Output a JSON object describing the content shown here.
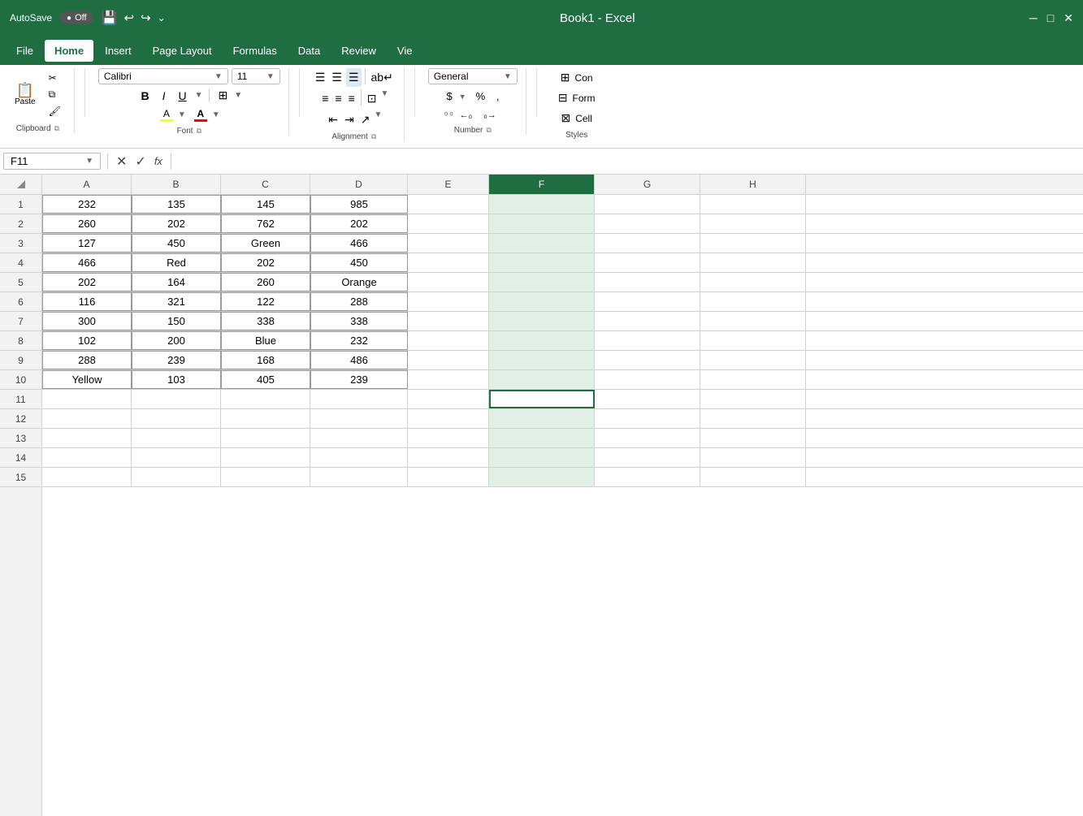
{
  "titleBar": {
    "autosave": "AutoSave",
    "autosave_state": "Off",
    "title": "Book1 - Excel",
    "quickAccess": [
      "save-icon",
      "undo-icon",
      "redo-icon",
      "customize-icon"
    ]
  },
  "menuBar": {
    "items": [
      "File",
      "Home",
      "Insert",
      "Page Layout",
      "Formulas",
      "Data",
      "Review",
      "View"
    ],
    "active": "Home"
  },
  "ribbon": {
    "groups": {
      "clipboard": {
        "label": "Clipboard",
        "paste_label": "Paste"
      },
      "font": {
        "label": "Font",
        "font_name": "Calibri",
        "font_size": "11",
        "bold": "B",
        "italic": "I",
        "underline": "U"
      },
      "alignment": {
        "label": "Alignment"
      },
      "number": {
        "label": "Number",
        "format": "General"
      },
      "styles": {
        "label": "Styles",
        "conditional": "Con",
        "format_as_table": "Form",
        "cell_styles": "Cell"
      }
    }
  },
  "formulaBar": {
    "nameBox": "F11",
    "formula": ""
  },
  "columns": [
    "A",
    "B",
    "C",
    "D",
    "E",
    "F",
    "G",
    "H"
  ],
  "rows": [
    1,
    2,
    3,
    4,
    5,
    6,
    7,
    8,
    9,
    10,
    11,
    12,
    13,
    14,
    15
  ],
  "tableData": {
    "headers": [
      "A",
      "B",
      "C",
      "D"
    ],
    "rows": [
      [
        "232",
        "135",
        "145",
        "985"
      ],
      [
        "260",
        "202",
        "762",
        "202"
      ],
      [
        "127",
        "450",
        "Green",
        "466"
      ],
      [
        "466",
        "Red",
        "202",
        "450"
      ],
      [
        "202",
        "164",
        "260",
        "Orange"
      ],
      [
        "116",
        "321",
        "122",
        "288"
      ],
      [
        "300",
        "150",
        "338",
        "338"
      ],
      [
        "102",
        "200",
        "Blue",
        "232"
      ],
      [
        "288",
        "239",
        "168",
        "486"
      ],
      [
        "Yellow",
        "103",
        "405",
        "239"
      ]
    ]
  },
  "activeCell": {
    "ref": "F11",
    "col": "F",
    "row": 11
  },
  "colors": {
    "excel_green": "#1e6e42",
    "header_bg": "#f2f2f2",
    "grid_border": "#d1d1d1",
    "table_border": "#999",
    "active_cell_outline": "#1e6e42",
    "selected_col_bg": "#e3f0e8"
  }
}
